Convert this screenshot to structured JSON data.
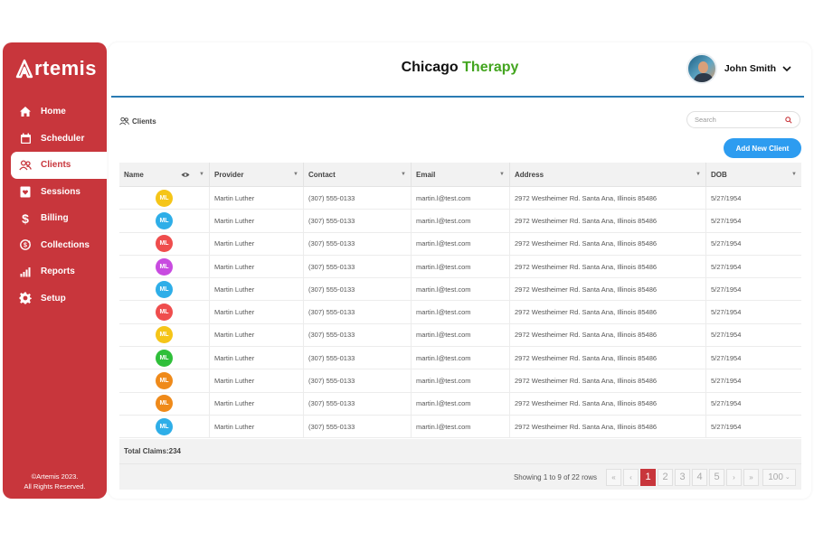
{
  "app": {
    "logo_text": "rtemis",
    "logo_initial": "A",
    "copyright_line1": "©Artemis 2023.",
    "copyright_line2": "All Rights Reserved."
  },
  "sidebar": {
    "items": [
      {
        "label": "Home",
        "icon": "home-icon",
        "active": false
      },
      {
        "label": "Scheduler",
        "icon": "calendar-icon",
        "active": false
      },
      {
        "label": "Clients",
        "icon": "users-icon",
        "active": true
      },
      {
        "label": "Sessions",
        "icon": "heart-folder-icon",
        "active": false
      },
      {
        "label": "Billing",
        "icon": "dollar-icon",
        "active": false
      },
      {
        "label": "Collections",
        "icon": "cycle-dollar-icon",
        "active": false
      },
      {
        "label": "Reports",
        "icon": "bar-chart-icon",
        "active": false
      },
      {
        "label": "Setup",
        "icon": "gear-icon",
        "active": false
      }
    ]
  },
  "header": {
    "title_part1": "Chicago",
    "title_part2": "Therapy",
    "user_name": "John Smith"
  },
  "breadcrumb": {
    "label": "Clients"
  },
  "search": {
    "placeholder": "Search"
  },
  "actions": {
    "add_client": "Add New Client"
  },
  "table": {
    "columns": [
      "Name",
      "Provider",
      "Contact",
      "Email",
      "Address",
      "DOB"
    ],
    "rows": [
      {
        "initials": "ML",
        "color": "#f5c518",
        "provider": "Martin Luther",
        "contact": "(307) 555-0133",
        "email": "martin.l@test.com",
        "address": "2972 Westheimer Rd. Santa Ana, Illinois 85486",
        "dob": "5/27/1954"
      },
      {
        "initials": "ML",
        "color": "#2eaee8",
        "provider": "Martin Luther",
        "contact": "(307) 555-0133",
        "email": "martin.l@test.com",
        "address": "2972 Westheimer Rd. Santa Ana, Illinois 85486",
        "dob": "5/27/1954"
      },
      {
        "initials": "ML",
        "color": "#ef4d4d",
        "provider": "Martin Luther",
        "contact": "(307) 555-0133",
        "email": "martin.l@test.com",
        "address": "2972 Westheimer Rd. Santa Ana, Illinois 85486",
        "dob": "5/27/1954"
      },
      {
        "initials": "ML",
        "color": "#c84be0",
        "provider": "Martin Luther",
        "contact": "(307) 555-0133",
        "email": "martin.l@test.com",
        "address": "2972 Westheimer Rd. Santa Ana, Illinois 85486",
        "dob": "5/27/1954"
      },
      {
        "initials": "ML",
        "color": "#2eaee8",
        "provider": "Martin Luther",
        "contact": "(307) 555-0133",
        "email": "martin.l@test.com",
        "address": "2972 Westheimer Rd. Santa Ana, Illinois 85486",
        "dob": "5/27/1954"
      },
      {
        "initials": "ML",
        "color": "#ef4d4d",
        "provider": "Martin Luther",
        "contact": "(307) 555-0133",
        "email": "martin.l@test.com",
        "address": "2972 Westheimer Rd. Santa Ana, Illinois 85486",
        "dob": "5/27/1954"
      },
      {
        "initials": "ML",
        "color": "#f5c518",
        "provider": "Martin Luther",
        "contact": "(307) 555-0133",
        "email": "martin.l@test.com",
        "address": "2972 Westheimer Rd. Santa Ana, Illinois 85486",
        "dob": "5/27/1954"
      },
      {
        "initials": "ML",
        "color": "#2fbf3a",
        "provider": "Martin Luther",
        "contact": "(307) 555-0133",
        "email": "martin.l@test.com",
        "address": "2972 Westheimer Rd. Santa Ana, Illinois 85486",
        "dob": "5/27/1954"
      },
      {
        "initials": "ML",
        "color": "#ef8a1a",
        "provider": "Martin Luther",
        "contact": "(307) 555-0133",
        "email": "martin.l@test.com",
        "address": "2972 Westheimer Rd. Santa Ana, Illinois 85486",
        "dob": "5/27/1954"
      },
      {
        "initials": "ML",
        "color": "#ef8a1a",
        "provider": "Martin Luther",
        "contact": "(307) 555-0133",
        "email": "martin.l@test.com",
        "address": "2972 Westheimer Rd. Santa Ana, Illinois 85486",
        "dob": "5/27/1954"
      },
      {
        "initials": "ML",
        "color": "#2eaee8",
        "provider": "Martin Luther",
        "contact": "(307) 555-0133",
        "email": "martin.l@test.com",
        "address": "2972 Westheimer Rd. Santa Ana, Illinois 85486",
        "dob": "5/27/1954"
      }
    ],
    "total_label": "Total Claims:234"
  },
  "pagination": {
    "showing": "Showing 1 to 9 of 22 rows",
    "first": "«",
    "prev": "‹",
    "pages": [
      "1",
      "2",
      "3",
      "4",
      "5"
    ],
    "active_page": "1",
    "next": "›",
    "last": "»",
    "page_size": "100"
  },
  "colors": {
    "brand_red": "#c8363c",
    "accent_green": "#43a51f",
    "button_blue": "#2d9cf0",
    "header_rule_blue": "#2a7bb3"
  }
}
